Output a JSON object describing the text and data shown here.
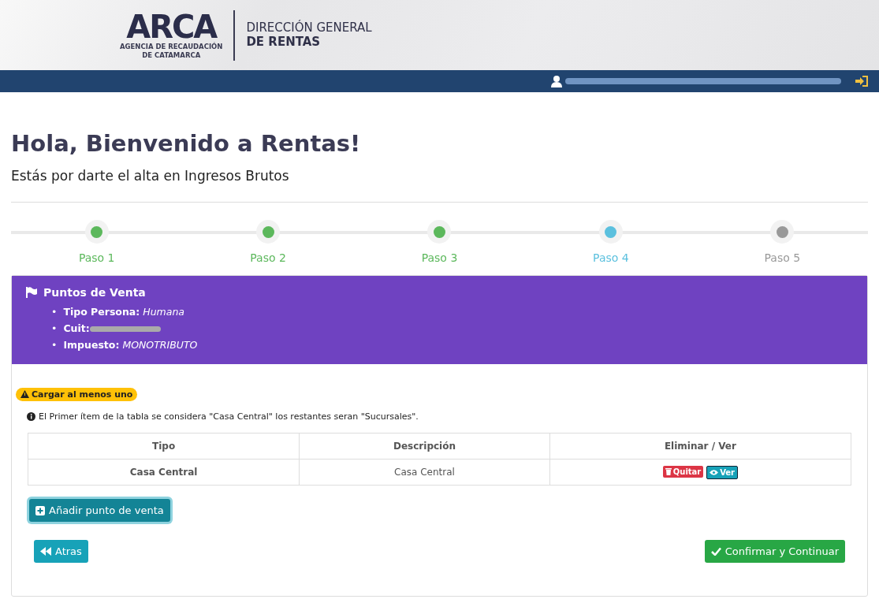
{
  "header": {
    "logo_text": "ARCA",
    "agency": "AGENCIA DE RECAUDACIÓN",
    "agency_place": "DE CATAMARCA",
    "org_line1": "DIRECCIÓN GENERAL",
    "org_line2": "DE RENTAS"
  },
  "title": "Hola, Bienvenido a Rentas!",
  "subtitle": "Estás por darte el alta en Ingresos Brutos",
  "steps": [
    {
      "label": "Paso 1",
      "done": true,
      "current": false
    },
    {
      "label": "Paso 2",
      "done": true,
      "current": false
    },
    {
      "label": "Paso 3",
      "done": true,
      "current": false
    },
    {
      "label": "Paso 4",
      "done": false,
      "current": true
    },
    {
      "label": "Paso 5",
      "done": false,
      "current": false
    }
  ],
  "panel": {
    "title": "Puntos de Venta",
    "details": [
      {
        "bullet": "•",
        "label": "Tipo Persona:",
        "value": "Humana"
      },
      {
        "bullet": "•",
        "label": "Cuit:",
        "redacted": true
      },
      {
        "bullet": "•",
        "label": "Impuesto:",
        "value": "MONOTRIBUTO"
      }
    ]
  },
  "warning_badge": "Cargar al menos uno",
  "info_note": "El Primer ítem de la tabla se considera \"Casa Central\" los restantes seran \"Sucursales\".",
  "table": {
    "columns": [
      "Tipo",
      "Descripción",
      "Eliminar / Ver"
    ],
    "rows": [
      {
        "tipo": "Casa Central",
        "descripcion": "Casa Central",
        "actions": [
          "Quitar",
          "Ver"
        ]
      }
    ]
  },
  "add_button": "Añadir punto de venta",
  "back_button": "Atras",
  "confirm_button": "Confirmar y Continuar"
}
